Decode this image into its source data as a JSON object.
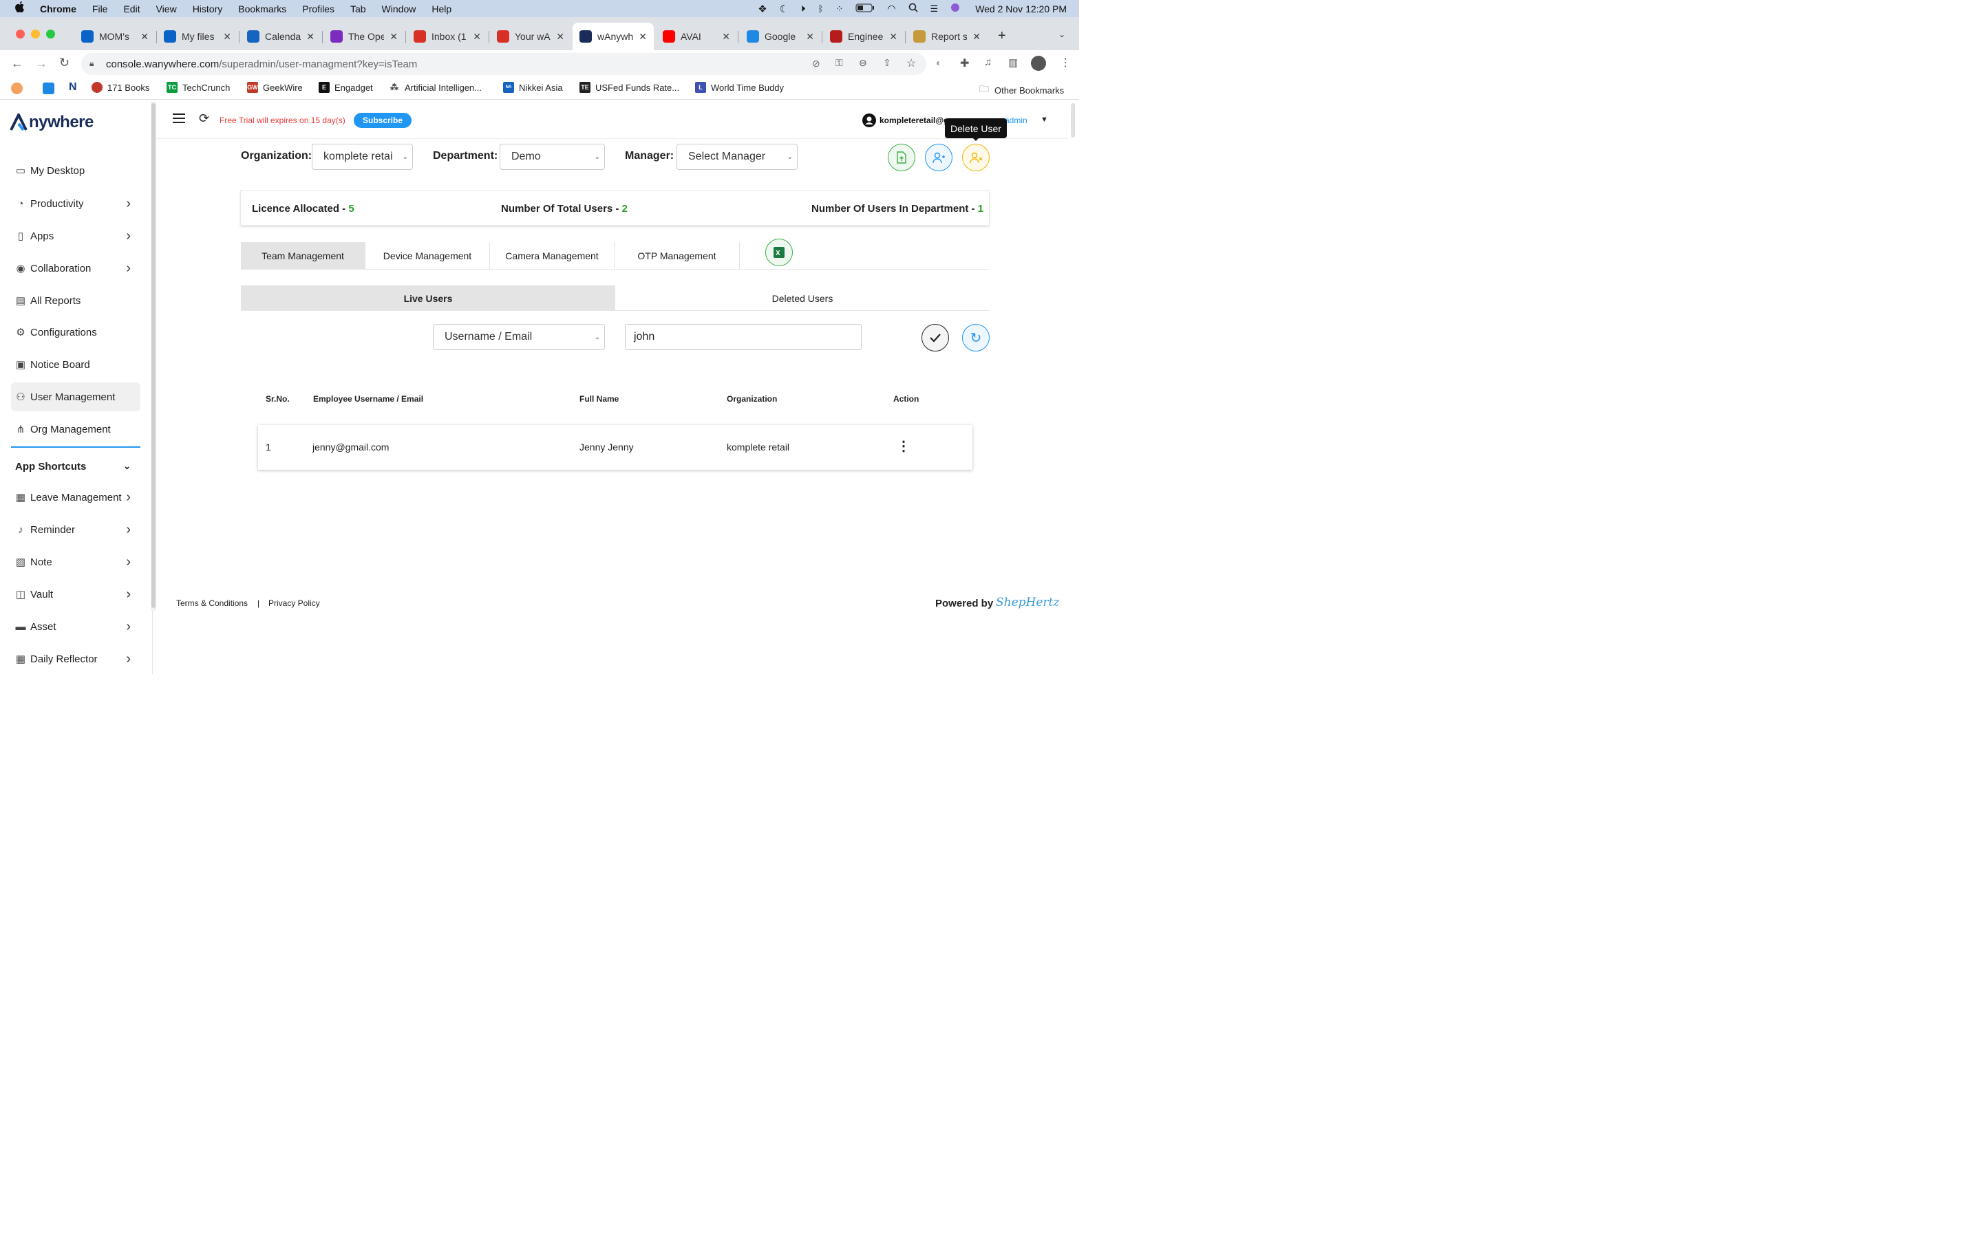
{
  "menubar": {
    "app": "Chrome",
    "items": [
      "File",
      "Edit",
      "View",
      "History",
      "Bookmarks",
      "Profiles",
      "Tab",
      "Window",
      "Help"
    ],
    "clock": "Wed 2 Nov  12:20 PM"
  },
  "tabs": [
    {
      "label": "MOM's",
      "icon": "onedrive-icon",
      "color": "#0a64c8"
    },
    {
      "label": "My files",
      "icon": "onedrive-icon",
      "color": "#0a64c8"
    },
    {
      "label": "Calendar",
      "icon": "calendar-icon",
      "color": "#1565c0"
    },
    {
      "label": "The Ope",
      "icon": "open-icon",
      "color": "#7b2cbf"
    },
    {
      "label": "Inbox (1",
      "icon": "gmail-icon",
      "color": "#d93025"
    },
    {
      "label": "Your wA",
      "icon": "gmail-icon",
      "color": "#d93025"
    },
    {
      "label": "wAnywh",
      "icon": "wanywhere-icon",
      "color": "#1a2d5a"
    },
    {
      "label": "AVAI",
      "icon": "youtube-icon",
      "color": "#ff0000"
    },
    {
      "label": "Google",
      "icon": "google-sheets-icon",
      "color": "#1e88e5"
    },
    {
      "label": "Enginee",
      "icon": "n-icon",
      "color": "#b71c1c"
    },
    {
      "label": "Report s",
      "icon": "report-icon",
      "color": "#c49a3a"
    }
  ],
  "address": {
    "host": "console.wanywhere.com",
    "path": "/superadmin/user-managment?key=isTeam"
  },
  "bookmarks": [
    "171 Books",
    "TechCrunch",
    "GeekWire",
    "Engadget",
    "Artificial Intelligen...",
    "Nikkei Asia",
    "USFed Funds Rate...",
    "World Time Buddy"
  ],
  "other_bookmarks": "Other Bookmarks",
  "brand": {
    "logo_text": "nywhere"
  },
  "sidebar": {
    "items": [
      {
        "label": "My Desktop",
        "icon": "monitor-icon",
        "chevron": false
      },
      {
        "label": "Productivity",
        "icon": "pie-chart-icon",
        "chevron": true
      },
      {
        "label": "Apps",
        "icon": "phone-icon",
        "chevron": true
      },
      {
        "label": "Collaboration",
        "icon": "globe-icon",
        "chevron": true
      },
      {
        "label": "All Reports",
        "icon": "clipboard-icon",
        "chevron": false
      },
      {
        "label": "Configurations",
        "icon": "gear-icon",
        "chevron": false
      },
      {
        "label": "Notice Board",
        "icon": "board-icon",
        "chevron": false
      },
      {
        "label": "User Management",
        "icon": "users-icon",
        "chevron": false,
        "active": true
      },
      {
        "label": "Org Management",
        "icon": "org-icon",
        "chevron": false
      }
    ],
    "shortcuts_title": "App Shortcuts",
    "shortcuts": [
      {
        "label": "Leave Management",
        "icon": "calendar-icon"
      },
      {
        "label": "Reminder",
        "icon": "bell-icon"
      },
      {
        "label": "Note",
        "icon": "note-icon"
      },
      {
        "label": "Vault",
        "icon": "vault-icon"
      },
      {
        "label": "Asset",
        "icon": "asset-icon"
      },
      {
        "label": "Daily Reflector",
        "icon": "reflector-icon"
      }
    ]
  },
  "topbar": {
    "trial": "Free Trial will expires on 15 day(s)",
    "subscribe": "Subscribe",
    "user_email": "kompleteretail@g",
    "role": "admin",
    "tooltip": "Delete User"
  },
  "filters": {
    "org_label": "Organization:",
    "org_value": "komplete retai",
    "dept_label": "Department:",
    "dept_value": "Demo",
    "mgr_label": "Manager:",
    "mgr_value": "Select Manager"
  },
  "summary": {
    "licence_label": "Licence Allocated - ",
    "licence_value": "5",
    "total_label": "Number Of Total Users - ",
    "total_value": "2",
    "dept_label": "Number Of Users In Department - ",
    "dept_value": "1"
  },
  "main_tabs": [
    "Team Management",
    "Device Management",
    "Camera Management",
    "OTP Management"
  ],
  "sub_tabs": [
    "Live Users",
    "Deleted Users"
  ],
  "search": {
    "field": "Username / Email",
    "value": "john"
  },
  "table": {
    "headers": [
      "Sr.No.",
      "Employee Username / Email",
      "Full Name",
      "Organization",
      "Action"
    ],
    "rows": [
      {
        "sr": "1",
        "email": "jenny@gmail.com",
        "name": "Jenny Jenny",
        "org": "komplete retail"
      }
    ]
  },
  "footer": {
    "terms": "Terms & Conditions",
    "sep": "|",
    "privacy": "Privacy Policy",
    "powered": "Powered by",
    "brand": "ShepHertz"
  },
  "colors": {
    "accent": "#2196f3",
    "green": "#2ca02c",
    "trial_red": "#e53935"
  }
}
